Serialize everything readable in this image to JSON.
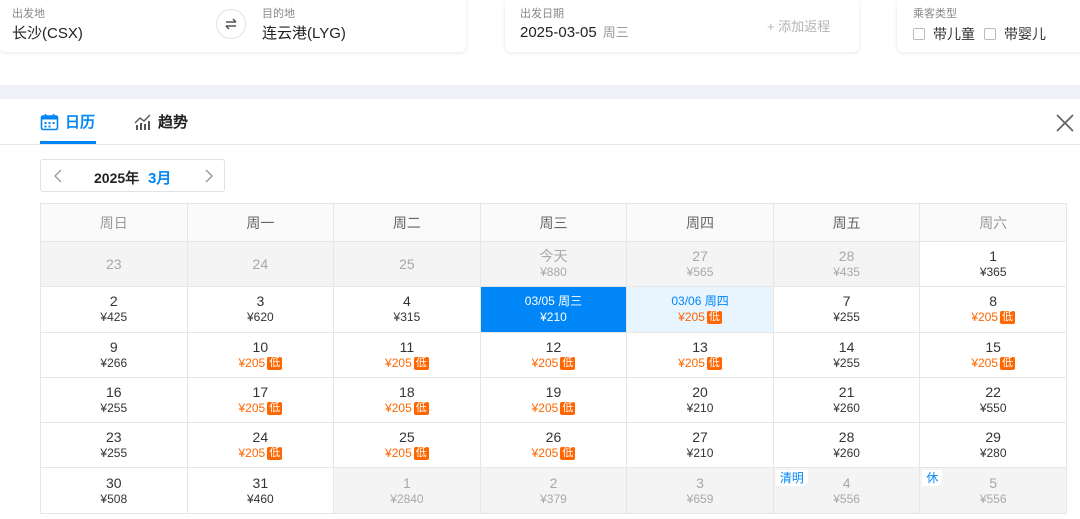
{
  "search": {
    "departure_label": "出发地",
    "departure_value": "长沙(CSX)",
    "destination_label": "目的地",
    "destination_value": "连云港(LYG)",
    "date_label": "出发日期",
    "date_value": "2025-03-05",
    "date_weekday": "周三",
    "add_return": "+ 添加返程",
    "passenger_label": "乘客类型",
    "with_child": "带儿童",
    "with_infant": "带婴儿"
  },
  "tabs": {
    "calendar": "日历",
    "trend": "趋势"
  },
  "month_selector": {
    "year": "2025年",
    "month": "3月"
  },
  "low_tag": "低",
  "colors": {
    "accent": "#0086f6",
    "low_price": "#ff6600"
  },
  "calendar": {
    "weekdays": [
      "周日",
      "周一",
      "周二",
      "周三",
      "周四",
      "周五",
      "周六"
    ],
    "rows": [
      [
        {
          "day": "23",
          "price": "",
          "state": "past"
        },
        {
          "day": "24",
          "price": "",
          "state": "past"
        },
        {
          "day": "25",
          "price": "",
          "state": "past"
        },
        {
          "day": "今天",
          "price": "¥880",
          "state": "past"
        },
        {
          "day": "27",
          "price": "¥565",
          "state": "past"
        },
        {
          "day": "28",
          "price": "¥435",
          "state": "past"
        },
        {
          "day": "1",
          "price": "¥365",
          "state": "normal"
        }
      ],
      [
        {
          "day": "2",
          "price": "¥425",
          "state": "normal"
        },
        {
          "day": "3",
          "price": "¥620",
          "state": "normal"
        },
        {
          "day": "4",
          "price": "¥315",
          "state": "normal"
        },
        {
          "day": "03/05 周三",
          "price": "¥210",
          "state": "selected"
        },
        {
          "day": "03/06 周四",
          "price": "¥205",
          "state": "ret",
          "low": true
        },
        {
          "day": "7",
          "price": "¥255",
          "state": "normal"
        },
        {
          "day": "8",
          "price": "¥205",
          "state": "normal",
          "low": true
        }
      ],
      [
        {
          "day": "9",
          "price": "¥266",
          "state": "normal"
        },
        {
          "day": "10",
          "price": "¥205",
          "state": "normal",
          "low": true
        },
        {
          "day": "11",
          "price": "¥205",
          "state": "normal",
          "low": true
        },
        {
          "day": "12",
          "price": "¥205",
          "state": "normal",
          "low": true
        },
        {
          "day": "13",
          "price": "¥205",
          "state": "normal",
          "low": true
        },
        {
          "day": "14",
          "price": "¥255",
          "state": "normal"
        },
        {
          "day": "15",
          "price": "¥205",
          "state": "normal",
          "low": true
        }
      ],
      [
        {
          "day": "16",
          "price": "¥255",
          "state": "normal"
        },
        {
          "day": "17",
          "price": "¥205",
          "state": "normal",
          "low": true
        },
        {
          "day": "18",
          "price": "¥205",
          "state": "normal",
          "low": true
        },
        {
          "day": "19",
          "price": "¥205",
          "state": "normal",
          "low": true
        },
        {
          "day": "20",
          "price": "¥210",
          "state": "normal"
        },
        {
          "day": "21",
          "price": "¥260",
          "state": "normal"
        },
        {
          "day": "22",
          "price": "¥550",
          "state": "normal"
        }
      ],
      [
        {
          "day": "23",
          "price": "¥255",
          "state": "normal"
        },
        {
          "day": "24",
          "price": "¥205",
          "state": "normal",
          "low": true
        },
        {
          "day": "25",
          "price": "¥205",
          "state": "normal",
          "low": true
        },
        {
          "day": "26",
          "price": "¥205",
          "state": "normal",
          "low": true
        },
        {
          "day": "27",
          "price": "¥210",
          "state": "normal"
        },
        {
          "day": "28",
          "price": "¥260",
          "state": "normal"
        },
        {
          "day": "29",
          "price": "¥280",
          "state": "normal"
        }
      ],
      [
        {
          "day": "30",
          "price": "¥508",
          "state": "normal"
        },
        {
          "day": "31",
          "price": "¥460",
          "state": "normal"
        },
        {
          "day": "1",
          "price": "¥2840",
          "state": "next"
        },
        {
          "day": "2",
          "price": "¥379",
          "state": "next"
        },
        {
          "day": "3",
          "price": "¥659",
          "state": "next"
        },
        {
          "day": "4",
          "price": "¥556",
          "state": "next",
          "holiday": "清明"
        },
        {
          "day": "5",
          "price": "¥556",
          "state": "next",
          "holiday": "休"
        }
      ]
    ]
  }
}
